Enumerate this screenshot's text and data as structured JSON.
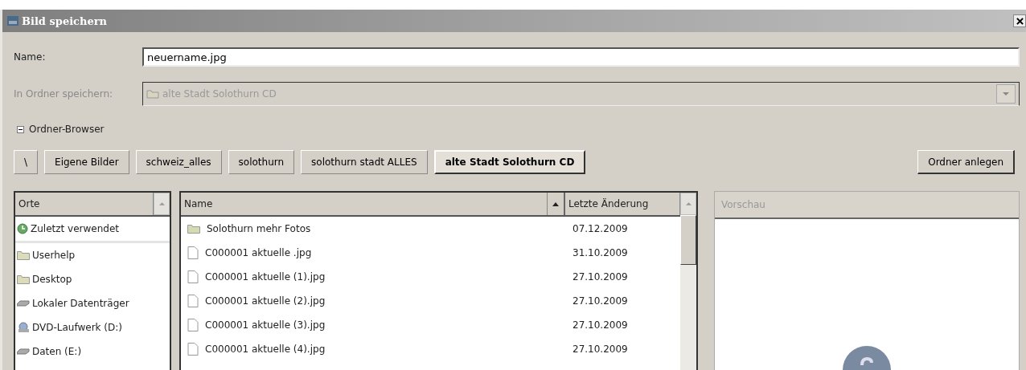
{
  "window": {
    "title": "Bild speichern"
  },
  "name_field": {
    "label": "Name:",
    "value": "neuername.jpg"
  },
  "folder_field": {
    "label": "In Ordner speichern:",
    "value": "alte Stadt Solothurn CD",
    "disabled": true
  },
  "browser_toggle": {
    "label": "Ordner-Browser",
    "expanded": true
  },
  "path_buttons": [
    {
      "label": "\\",
      "selected": false
    },
    {
      "label": "Eigene Bilder",
      "selected": false
    },
    {
      "label": "schweiz_alles",
      "selected": false
    },
    {
      "label": "solothurn",
      "selected": false
    },
    {
      "label": "solothurn stadt ALLES",
      "selected": false
    },
    {
      "label": "alte Stadt Solothurn CD",
      "selected": true
    }
  ],
  "create_folder_button": "Ordner anlegen",
  "places": {
    "header": "Orte",
    "items": [
      {
        "kind": "recent",
        "label": "Zuletzt verwendet"
      },
      {
        "kind": "folder",
        "label": "Userhelp"
      },
      {
        "kind": "folder",
        "label": "Desktop"
      },
      {
        "kind": "drive",
        "label": "Lokaler Datenträger"
      },
      {
        "kind": "dvd",
        "label": "DVD-Laufwerk (D:)"
      },
      {
        "kind": "drive",
        "label": "Daten (E:)"
      }
    ]
  },
  "files": {
    "columns": [
      "Name",
      "Letzte Änderung"
    ],
    "rows": [
      {
        "kind": "folder",
        "name": "Solothurn mehr Fotos",
        "date": "07.12.2009"
      },
      {
        "kind": "file",
        "name": "C000001 aktuelle .jpg",
        "date": "31.10.2009"
      },
      {
        "kind": "file",
        "name": "C000001 aktuelle (1).jpg",
        "date": "27.10.2009"
      },
      {
        "kind": "file",
        "name": "C000001 aktuelle (2).jpg",
        "date": "27.10.2009"
      },
      {
        "kind": "file",
        "name": "C000001 aktuelle (3).jpg",
        "date": "27.10.2009"
      },
      {
        "kind": "file",
        "name": "C000001 aktuelle (4).jpg",
        "date": "27.10.2009"
      }
    ]
  },
  "preview": {
    "header": "Vorschau"
  }
}
